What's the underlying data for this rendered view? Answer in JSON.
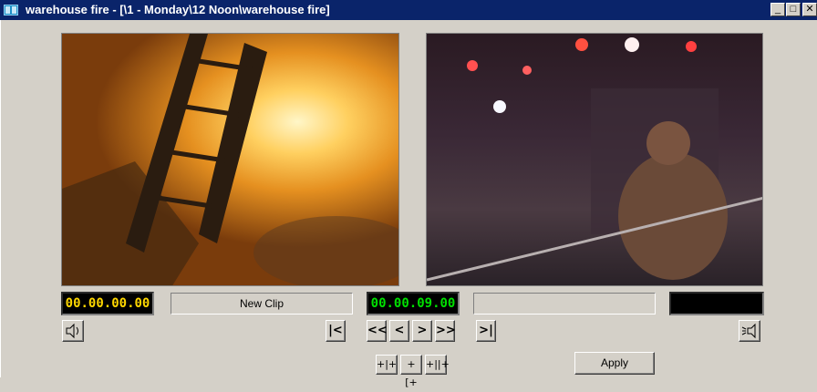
{
  "window": {
    "title": "warehouse fire - [\\1 - Monday\\12 Noon\\warehouse fire]",
    "minimize_glyph": "_",
    "maximize_glyph": "□",
    "close_glyph": "✕"
  },
  "source": {
    "timecode": "00.00.00.00",
    "clip_name": "New Clip"
  },
  "record": {
    "timecode": "00.00.09.00",
    "clip_name": ""
  },
  "transport": {
    "go_in": "|<",
    "rewind": "<<",
    "step_back": "<",
    "step_forward": ">",
    "fast_forward": ">>",
    "go_out": ">|"
  },
  "splice": {
    "left": "+|+",
    "center": "+[+",
    "right": "+||+"
  },
  "apply_label": "Apply",
  "colors": {
    "titlebar": "#0a246a",
    "timecode_source": "#ffd700",
    "timecode_record": "#00e000",
    "panel": "#d4d0c8"
  },
  "icons": {
    "audio": "speaker-icon",
    "output": "output-speaker-icon"
  }
}
